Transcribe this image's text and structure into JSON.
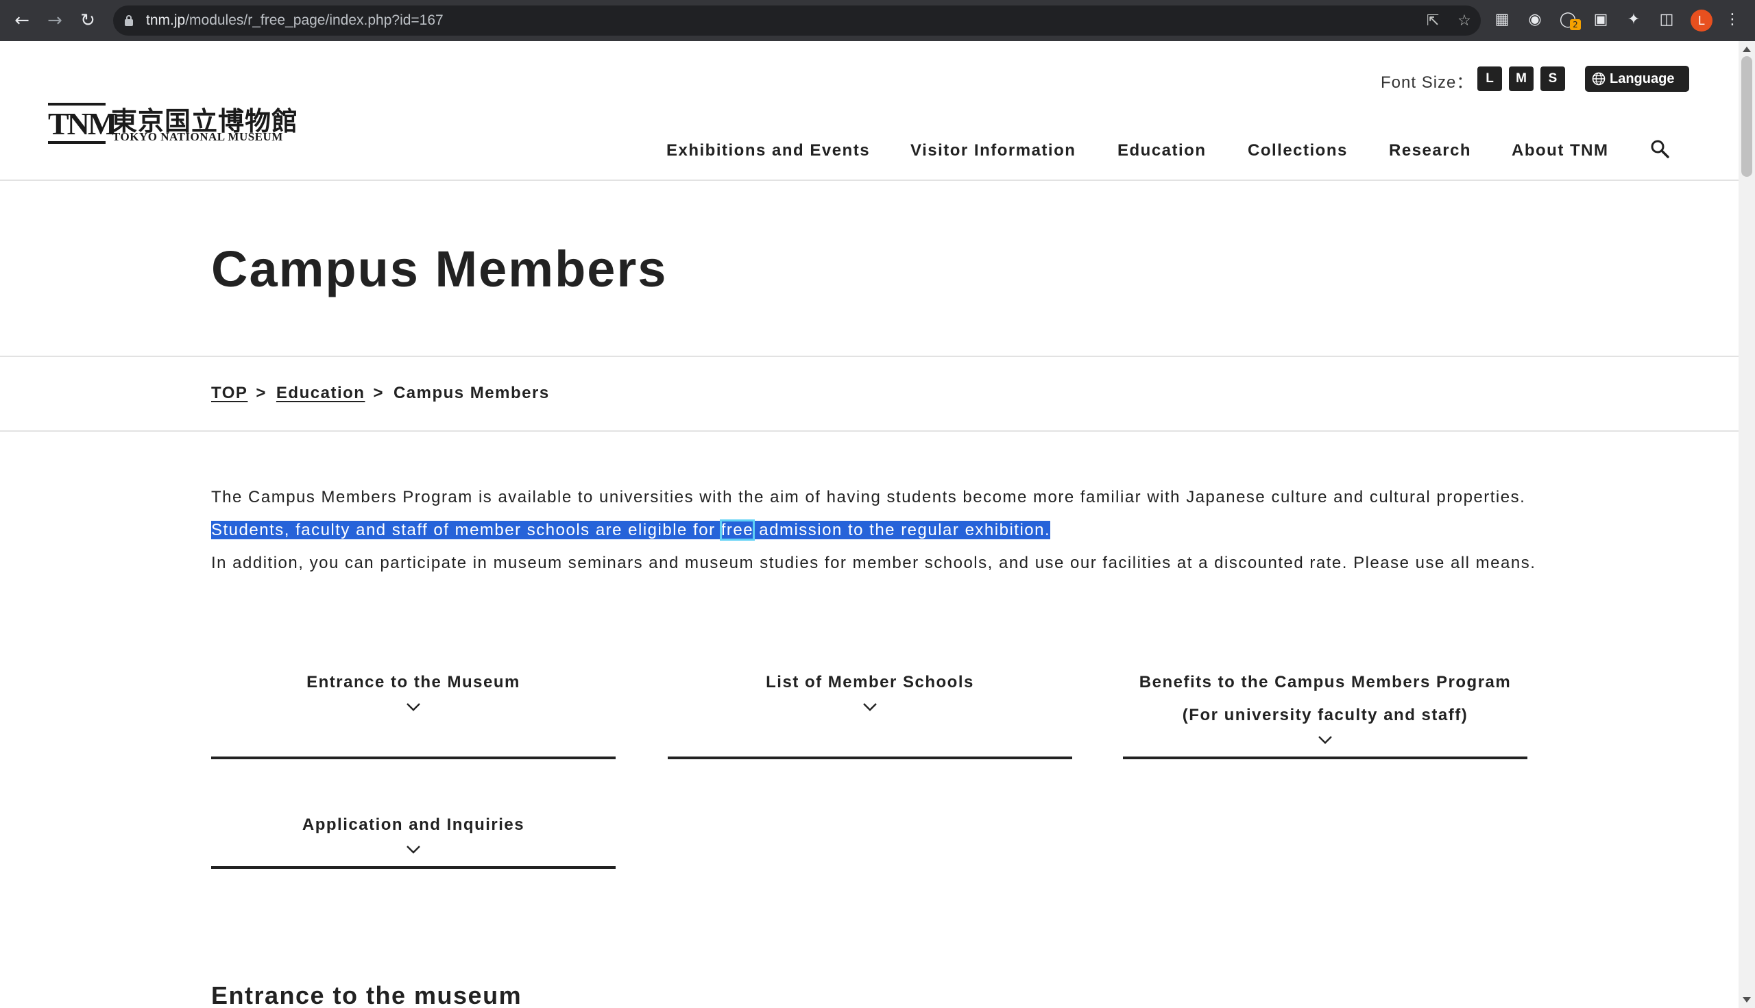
{
  "browser": {
    "url_host": "tnm.jp",
    "url_path": "/modules/r_free_page/index.php?id=167",
    "profile_initial": "L",
    "extension_badge": "2",
    "icons": [
      "back-icon",
      "forward-icon",
      "reload-icon",
      "lock-icon",
      "share-icon",
      "star-icon",
      "qr-icon",
      "cookie-icon",
      "extension-icon",
      "puzzle-icon",
      "sidepanel-icon",
      "more-icon"
    ]
  },
  "header": {
    "logo_tnm": "TNM",
    "logo_jp": "東京国立博物館",
    "logo_en": "TOKYO NATIONAL MUSEUM",
    "font_size_label": "Font Size：",
    "font_sizes": [
      "L",
      "M",
      "S"
    ],
    "language_label": "Language",
    "nav": [
      "Exhibitions and Events",
      "Visitor Information",
      "Education",
      "Collections",
      "Research",
      "About TNM"
    ]
  },
  "page": {
    "title": "Campus Members",
    "breadcrumb": {
      "top": "TOP",
      "education": "Education",
      "current": "Campus Members",
      "separator": ">"
    },
    "intro": {
      "line1": "The Campus Members Program is available to universities with the aim of having students become more familiar with Japanese culture and cultural properties.",
      "line2_before": "Students, faculty and staff of member schools are eligible for ",
      "line2_word": "free",
      "line2_after": " admission to the regular exhibition.",
      "line3": "In addition, you can participate in museum seminars and museum studies for member schools, and use our facilities at a discounted rate. Please use all means."
    },
    "anchors": [
      "Entrance to the Museum",
      "List of Member Schools",
      "Benefits to the Campus Members Program (For university faculty and staff)",
      "Application and Inquiries"
    ],
    "section_heading": "Entrance to the museum"
  },
  "colors": {
    "chrome": "#35363a",
    "selection": "#2663d9",
    "text": "#222222"
  }
}
